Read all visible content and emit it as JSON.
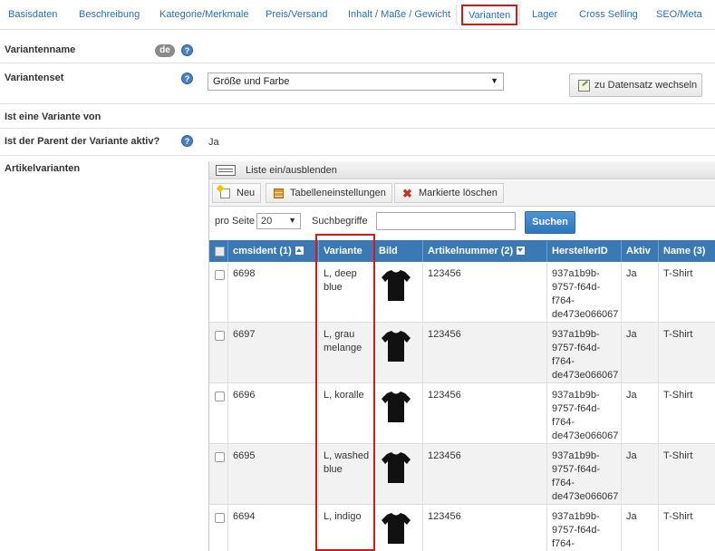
{
  "tabs": [
    {
      "label": "Basisdaten",
      "active": false
    },
    {
      "label": "Beschreibung",
      "active": false
    },
    {
      "label": "Kategorie/Merkmale",
      "active": false
    },
    {
      "label": "Preis/Versand",
      "active": false
    },
    {
      "label": "Inhalt / Maße / Gewicht",
      "active": false
    },
    {
      "label": "Varianten",
      "active": true
    },
    {
      "label": "Lager",
      "active": false
    },
    {
      "label": "Cross Selling",
      "active": false
    },
    {
      "label": "SEO/Meta",
      "active": false
    }
  ],
  "form": {
    "variant_name_label": "Variantenname",
    "lang_badge": "de",
    "variant_set_label": "Variantenset",
    "variant_set_value": "Größe und Farbe",
    "switch_button_label": "zu Datensatz wechseln",
    "variant_of_label": "Ist eine Variante von",
    "parent_active_label": "Ist der Parent der Variante aktiv?",
    "parent_active_value": "Ja",
    "article_variants_label": "Artikelvarianten",
    "help_glyph": "?"
  },
  "grid": {
    "toggle_label": "Liste ein/ausblenden",
    "toolbar": {
      "new_label": "Neu",
      "table_settings_label": "Tabelleneinstellungen",
      "delete_label": "Markierte löschen"
    },
    "filter": {
      "per_page_label": "pro Seite",
      "per_page_value": "20",
      "search_label": "Suchbegriffe",
      "search_value": "",
      "search_button": "Suchen"
    },
    "columns": {
      "cmsident": "cmsident (1)",
      "variante": "Variante",
      "bild": "Bild",
      "artikelnummer": "Artikelnummer (2)",
      "herstellerid": "HerstellerID",
      "aktiv": "Aktiv",
      "name": "Name (3)"
    },
    "rows": [
      {
        "cmsident": "6698",
        "variante": [
          "L, deep",
          "blue"
        ],
        "artikelnummer": "123456",
        "herstellerid": [
          "937a1b9b-",
          "9757-f64d-",
          "f764-",
          "de473e066067"
        ],
        "aktiv": "Ja",
        "name": "T-Shirt"
      },
      {
        "cmsident": "6697",
        "variante": [
          "L, grau",
          "melange"
        ],
        "artikelnummer": "123456",
        "herstellerid": [
          "937a1b9b-",
          "9757-f64d-",
          "f764-",
          "de473e066067"
        ],
        "aktiv": "Ja",
        "name": "T-Shirt"
      },
      {
        "cmsident": "6696",
        "variante": [
          "L, koralle",
          ""
        ],
        "artikelnummer": "123456",
        "herstellerid": [
          "937a1b9b-",
          "9757-f64d-",
          "f764-",
          "de473e066067"
        ],
        "aktiv": "Ja",
        "name": "T-Shirt"
      },
      {
        "cmsident": "6695",
        "variante": [
          "L, washed",
          "blue"
        ],
        "artikelnummer": "123456",
        "herstellerid": [
          "937a1b9b-",
          "9757-f64d-",
          "f764-",
          "de473e066067"
        ],
        "aktiv": "Ja",
        "name": "T-Shirt"
      },
      {
        "cmsident": "6694",
        "variante": [
          "L, indigo",
          ""
        ],
        "artikelnummer": "123456",
        "herstellerid": [
          "937a1b9b-",
          "9757-f64d-",
          "f764-",
          ""
        ],
        "aktiv": "Ja",
        "name": "T-Shirt"
      }
    ]
  },
  "colors": {
    "header_blue": "#3a79b3",
    "link_blue": "#2a6fb5",
    "highlight_red": "#d01b1b",
    "button_blue": "#2f76bd"
  }
}
